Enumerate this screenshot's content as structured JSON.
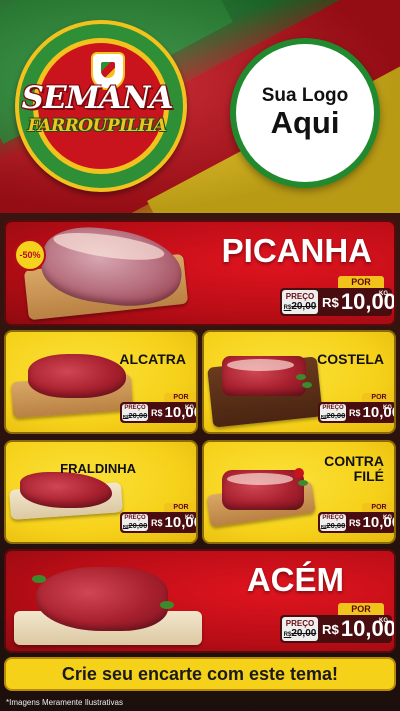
{
  "header": {
    "title_line1": "SEMANA",
    "title_line2": "FARROUPILHA",
    "logo_line1": "Sua Logo",
    "logo_line2": "Aqui"
  },
  "products": [
    {
      "name": "PICANHA",
      "discount": "-50%",
      "por_label": "POR",
      "price_label": "PREÇO",
      "old_currency": "R$",
      "old_price": "20,00",
      "currency": "R$",
      "price": "10,00",
      "unit": "KG"
    },
    {
      "name": "ALCATRA",
      "por_label": "POR",
      "price_label": "PREÇO",
      "old_currency": "R$",
      "old_price": "20,00",
      "currency": "R$",
      "price": "10,00",
      "unit": "KG"
    },
    {
      "name": "COSTELA",
      "por_label": "POR",
      "price_label": "PREÇO",
      "old_currency": "R$",
      "old_price": "20,00",
      "currency": "R$",
      "price": "10,00",
      "unit": "KG"
    },
    {
      "name": "FRALDINHA",
      "por_label": "POR",
      "price_label": "PREÇO",
      "old_currency": "R$",
      "old_price": "20,00",
      "currency": "R$",
      "price": "10,00",
      "unit": "KG"
    },
    {
      "name_line1": "CONTRA",
      "name_line2": "FILÉ",
      "por_label": "POR",
      "price_label": "PREÇO",
      "old_currency": "R$",
      "old_price": "20,00",
      "currency": "R$",
      "price": "10,00",
      "unit": "KG"
    },
    {
      "name": "ACÉM",
      "por_label": "POR",
      "price_label": "PREÇO",
      "old_currency": "R$",
      "old_price": "20,00",
      "currency": "R$",
      "price": "10,00",
      "unit": "KG"
    }
  ],
  "cta": "Crie seu encarte com este tema!",
  "footnote": "*Imagens Meramente Ilustrativas",
  "colors": {
    "red": "#c5111b",
    "green": "#2a8f36",
    "yellow": "#f6d11a",
    "dark": "#1a1210"
  },
  "icons": [
    "coat-of-arms-icon"
  ]
}
